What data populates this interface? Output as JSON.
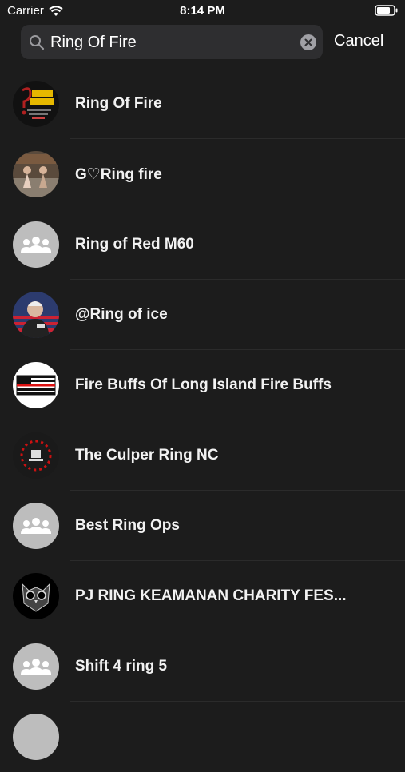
{
  "status_bar": {
    "carrier": "Carrier",
    "time": "8:14 PM"
  },
  "search": {
    "query": "Ring Of Fire",
    "cancel_label": "Cancel"
  },
  "results": [
    {
      "label": "Ring Of Fire",
      "avatar": "trivia-teasers-logo"
    },
    {
      "label": "G♡Ring fire",
      "avatar": "photo"
    },
    {
      "label": "Ring of Red M60",
      "avatar": "group-icon"
    },
    {
      "label": "@Ring of ice",
      "avatar": "photo"
    },
    {
      "label": "Fire Buffs Of Long Island Fire Buffs",
      "avatar": "flag-logo"
    },
    {
      "label": "The Culper Ring NC",
      "avatar": "emblem-logo"
    },
    {
      "label": "Best Ring Ops",
      "avatar": "group-icon"
    },
    {
      "label": "PJ RING KEAMANAN CHARITY FES...",
      "avatar": "owl-logo"
    },
    {
      "label": "Shift 4 ring 5",
      "avatar": "group-icon"
    }
  ]
}
